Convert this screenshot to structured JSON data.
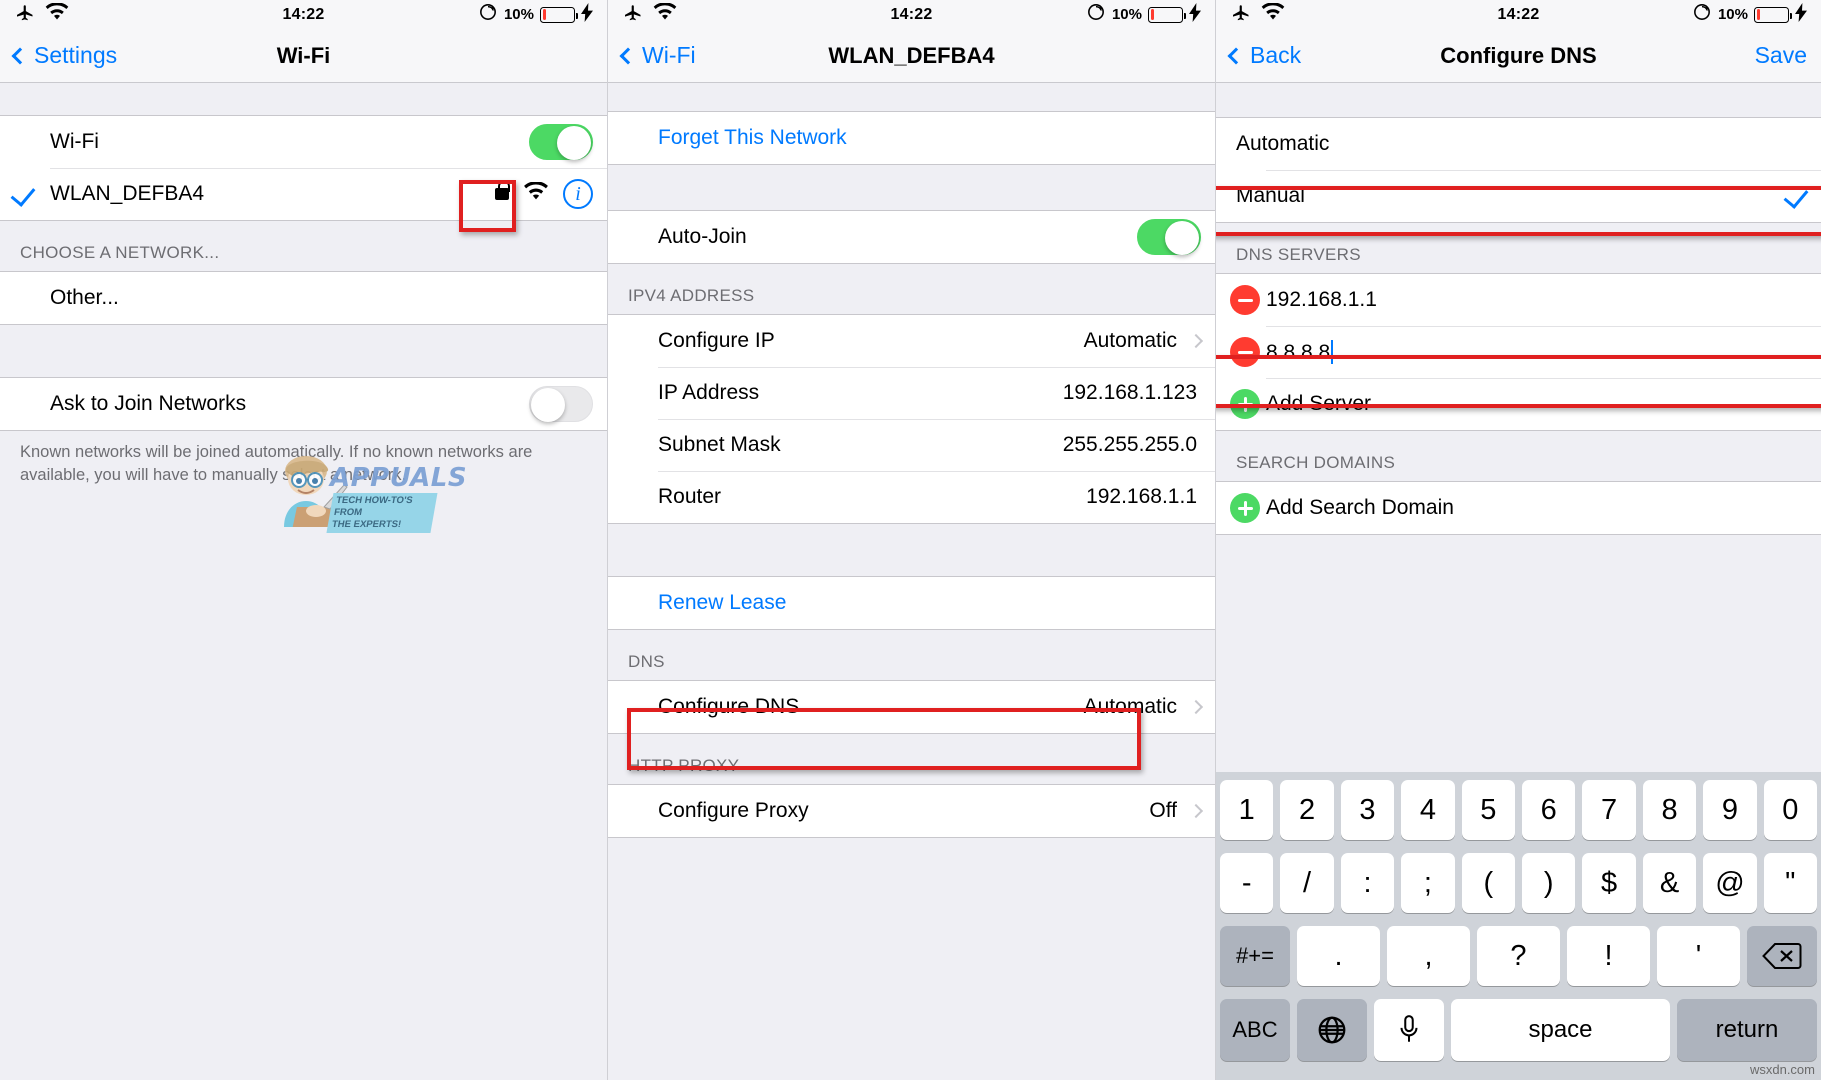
{
  "status_bar": {
    "time": "14:22",
    "battery_percent": "10%",
    "icons": [
      "airplane-mode-icon",
      "wifi-icon",
      "rotation-lock-icon",
      "battery-icon",
      "charging-bolt-icon"
    ]
  },
  "colors": {
    "accent_blue": "#007aff",
    "toggle_green": "#4cd964",
    "highlight_red": "#e02020",
    "destructive_red": "#ff3b30",
    "group_bg": "#efeff4"
  },
  "panel_wifi": {
    "nav": {
      "back_label": "Settings",
      "title": "Wi-Fi"
    },
    "wifi_row": {
      "label": "Wi-Fi",
      "toggle_state": "on"
    },
    "connected_network": {
      "name": "WLAN_DEFBA4",
      "checked": true,
      "secured": true,
      "signal": "wifi-icon",
      "info_button": "info-icon"
    },
    "choose_network_header": "CHOOSE A NETWORK...",
    "other_row": "Other...",
    "ask_to_join": {
      "label": "Ask to Join Networks",
      "toggle_state": "off"
    },
    "footnote": "Known networks will be joined automatically. If no known networks are available, you will have to manually select a network."
  },
  "panel_network": {
    "nav": {
      "back_label": "Wi-Fi",
      "title": "WLAN_DEFBA4"
    },
    "forget_network": "Forget This Network",
    "auto_join": {
      "label": "Auto-Join",
      "toggle_state": "on"
    },
    "ipv4_header": "IPV4 ADDRESS",
    "ipv4_rows": [
      {
        "label": "Configure IP",
        "value": "Automatic",
        "chevron": true
      },
      {
        "label": "IP Address",
        "value": "192.168.1.123",
        "chevron": false
      },
      {
        "label": "Subnet Mask",
        "value": "255.255.255.0",
        "chevron": false
      },
      {
        "label": "Router",
        "value": "192.168.1.1",
        "chevron": false
      }
    ],
    "renew_lease": "Renew Lease",
    "dns_header": "DNS",
    "configure_dns": {
      "label": "Configure DNS",
      "value": "Automatic",
      "chevron": true
    },
    "http_proxy_header": "HTTP PROXY",
    "configure_proxy": {
      "label": "Configure Proxy",
      "value": "Off",
      "chevron": true
    }
  },
  "panel_dns": {
    "nav": {
      "back_label": "Back",
      "title": "Configure DNS",
      "save_label": "Save"
    },
    "modes": [
      {
        "label": "Automatic",
        "selected": false
      },
      {
        "label": "Manual",
        "selected": true
      }
    ],
    "dns_servers_header": "DNS SERVERS",
    "servers": [
      {
        "value": "192.168.1.1",
        "editing": false
      },
      {
        "value": "8.8.8.8",
        "editing": true
      }
    ],
    "add_server": "Add Server",
    "search_domains_header": "SEARCH DOMAINS",
    "add_search_domain": "Add Search Domain"
  },
  "keyboard": {
    "row1": [
      "1",
      "2",
      "3",
      "4",
      "5",
      "6",
      "7",
      "8",
      "9",
      "0"
    ],
    "row2": [
      "-",
      "/",
      ":",
      ";",
      "(",
      ")",
      "$",
      "&",
      "@",
      "\""
    ],
    "row3": [
      "#+=",
      ".",
      ",",
      "?",
      "!",
      "'",
      "backspace-icon"
    ],
    "row4": [
      "ABC",
      "globe-icon",
      "microphone-icon",
      "space",
      "return"
    ]
  },
  "watermarks": {
    "brand": "APPUALS",
    "tagline_line1": "TECH HOW-TO'S FROM",
    "tagline_line2": "THE EXPERTS!",
    "site": "wsxdn.com"
  }
}
